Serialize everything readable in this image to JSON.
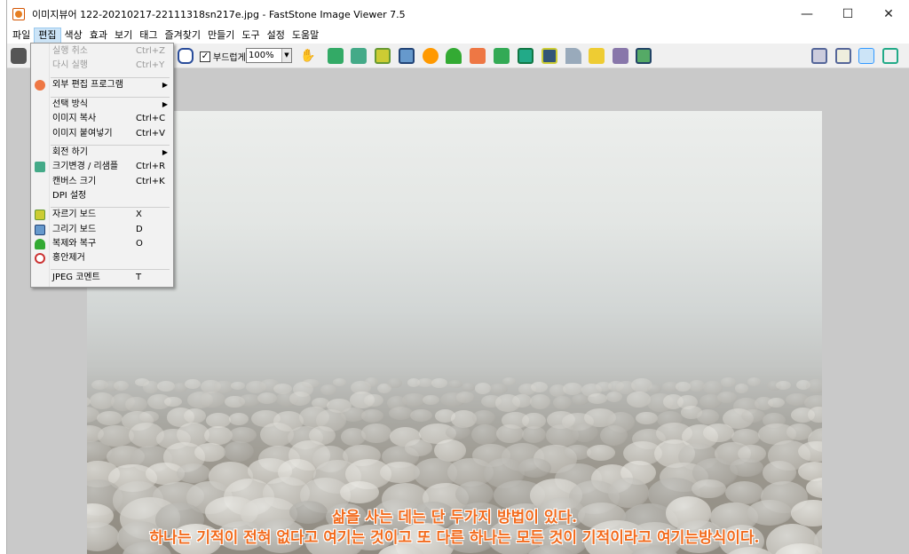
{
  "window": {
    "title": "이미지뷰어 122-20210217-22111318sn217e.jpg  -  FastStone Image Viewer 7.5",
    "minimize": "—",
    "maximize": "☐",
    "close": "✕"
  },
  "menubar": [
    "파일",
    "편집",
    "색상",
    "효과",
    "보기",
    "태그",
    "즐겨찾기",
    "만들기",
    "도구",
    "설정",
    "도움말"
  ],
  "toolbar": {
    "smooth_label": "부드럽게",
    "smooth_checked": "✓",
    "zoom": "100%"
  },
  "edit_menu": {
    "undo": {
      "label": "실행 취소",
      "shortcut": "Ctrl+Z"
    },
    "redo": {
      "label": "다시 실행",
      "shortcut": "Ctrl+Y"
    },
    "external_editor": {
      "label": "외부 편집 프로그램"
    },
    "selection_mode": {
      "label": "선택 방식"
    },
    "copy_image": {
      "label": "이미지 복사",
      "shortcut": "Ctrl+C"
    },
    "paste_image": {
      "label": "이미지 붙여넣기",
      "shortcut": "Ctrl+V"
    },
    "rotate": {
      "label": "회전 하기"
    },
    "resize": {
      "label": "크기변경 / 리샘플",
      "shortcut": "Ctrl+R"
    },
    "canvas_size": {
      "label": "캔버스 크기",
      "shortcut": "Ctrl+K"
    },
    "dpi": {
      "label": "DPI 설정"
    },
    "crop_board": {
      "label": "자르기 보드",
      "shortcut": "X"
    },
    "draw_board": {
      "label": "그리기 보드",
      "shortcut": "D"
    },
    "clone_heal": {
      "label": "복제와 복구",
      "shortcut": "O"
    },
    "red_eye": {
      "label": "홍안제거"
    },
    "jpeg_comment": {
      "label": "JPEG 코멘트",
      "shortcut": "T"
    }
  },
  "image_caption": {
    "line1": "삶을 사는 데는 단 두가지 방법이 있다.",
    "line2": "하나는 기적이 전혀 없다고 여기는 것이고 또 다른 하나는 모든 것이 기적이라고 여기는방식이다."
  },
  "colors": {
    "accent_orange": "#f26b1d",
    "menu_highlight": "#cce4f7",
    "viewer_bg": "#c9c9c9"
  }
}
